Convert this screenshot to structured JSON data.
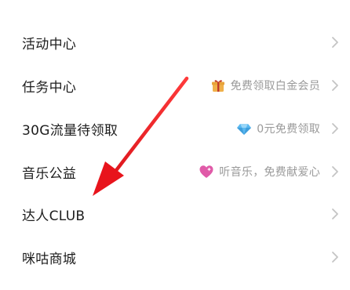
{
  "menu": {
    "items": [
      {
        "label": "活动中心",
        "hint": "",
        "hint_icon": ""
      },
      {
        "label": "任务中心",
        "hint": "免费领取白金会员",
        "hint_icon": "gift-icon"
      },
      {
        "label": "30G流量待领取",
        "hint": "0元免费领取",
        "hint_icon": "diamond-icon"
      },
      {
        "label": "音乐公益",
        "hint": "听音乐，免费献爱心",
        "hint_icon": "heart-icon"
      },
      {
        "label": "达人CLUB",
        "hint": "",
        "hint_icon": ""
      },
      {
        "label": "咪咕商城",
        "hint": "",
        "hint_icon": ""
      }
    ]
  },
  "annotation": {
    "color": "#e8141c",
    "points_to": "达人CLUB"
  },
  "colors": {
    "label": "#1d1d1d",
    "hint": "#9a9a9a",
    "chevron": "#c4c4c4",
    "gift": "#e8a33a",
    "diamond": "#5ab8f0",
    "heart": "#e05aa8"
  }
}
